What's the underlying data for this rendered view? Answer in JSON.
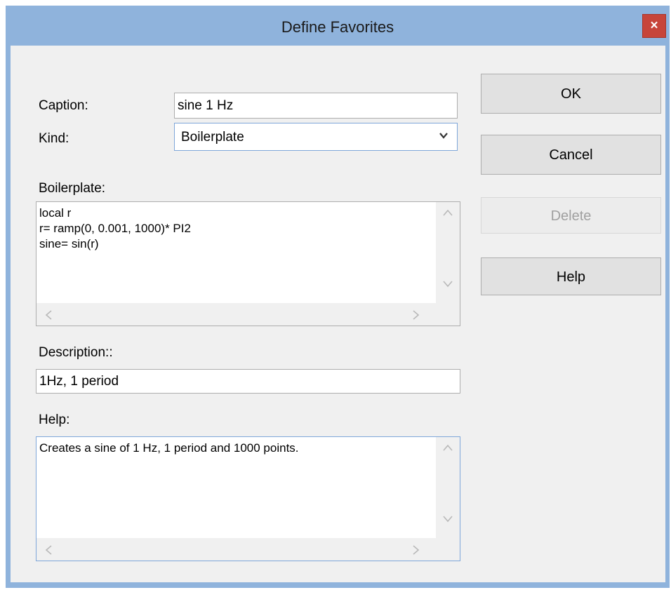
{
  "window": {
    "title": "Define Favorites",
    "close_glyph": "×"
  },
  "form": {
    "caption_label": "Caption:",
    "caption_value": "sine 1 Hz",
    "kind_label": "Kind:",
    "kind_value": "Boilerplate",
    "boilerplate_label": "Boilerplate:",
    "boilerplate_lines": [
      "local r",
      "r= ramp(0, 0.001, 1000)* PI2",
      "sine= sin(r)"
    ],
    "description_label": "Description::",
    "description_value": "1Hz, 1 period",
    "help_label": "Help:",
    "help_text": "Creates a sine of 1 Hz, 1 period and 1000 points."
  },
  "buttons": {
    "ok": "OK",
    "cancel": "Cancel",
    "delete": "Delete",
    "help": "Help"
  },
  "icons": {
    "close": "close-icon",
    "dropdown": "chevron-down-icon",
    "scroll_up": "chevron-up-icon",
    "scroll_down": "chevron-down-icon",
    "scroll_left": "chevron-left-icon",
    "scroll_right": "chevron-right-icon"
  },
  "colors": {
    "titlebar": "#8fb3dc",
    "close_button": "#c7453a",
    "dialog_background": "#f0f0f0",
    "focus_border": "#7ea6d9"
  }
}
